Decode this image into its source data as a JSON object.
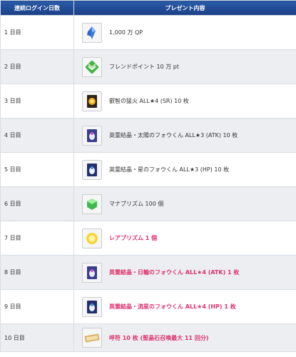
{
  "header": {
    "day_col": "連続ログイン日数",
    "gift_col": "プレゼント内容"
  },
  "rows": [
    {
      "day": "1 日目",
      "gift": "1,000 万 QP",
      "icon": "qp-crystal-icon",
      "highlight": false
    },
    {
      "day": "2 日目",
      "gift": "フレンドポイント 10 万 pt",
      "icon": "friend-point-icon",
      "highlight": false
    },
    {
      "day": "3 日目",
      "gift": "叡智の猛火 ALL★4 (SR) 10 枚",
      "icon": "fire-card-icon",
      "highlight": false
    },
    {
      "day": "4 日目",
      "gift": "英霊結晶・太陽のフォウくん ALL★3 (ATK) 10 枚",
      "icon": "fou-atk-card-icon",
      "highlight": false
    },
    {
      "day": "5 日目",
      "gift": "英霊結晶・星のフォウくん ALL★3 (HP) 10 枚",
      "icon": "fou-hp-card-icon",
      "highlight": false
    },
    {
      "day": "6 日目",
      "gift": "マナプリズム 100 個",
      "icon": "mana-prism-icon",
      "highlight": false
    },
    {
      "day": "7 日目",
      "gift": "レアプリズム 1 個",
      "icon": "rare-prism-icon",
      "highlight": true
    },
    {
      "day": "8 日目",
      "gift": "英霊結晶・日輪のフォウくん ALL★4 (ATK) 1 枚",
      "icon": "fou-atk-card-icon",
      "highlight": true
    },
    {
      "day": "9 日目",
      "gift": "英霊結晶・流星のフォウくん ALL★4 (HP) 1 枚",
      "icon": "fou-hp-card-icon",
      "highlight": true
    },
    {
      "day": "10 日目",
      "gift": "呼符 10 枚 (聖晶石召喚最大 11 回分)",
      "icon": "summon-ticket-icon",
      "highlight": true
    }
  ],
  "colors": {
    "header_bg": "#1f4a95",
    "highlight_text": "#e0306b",
    "alt_row": "#eceef1"
  }
}
